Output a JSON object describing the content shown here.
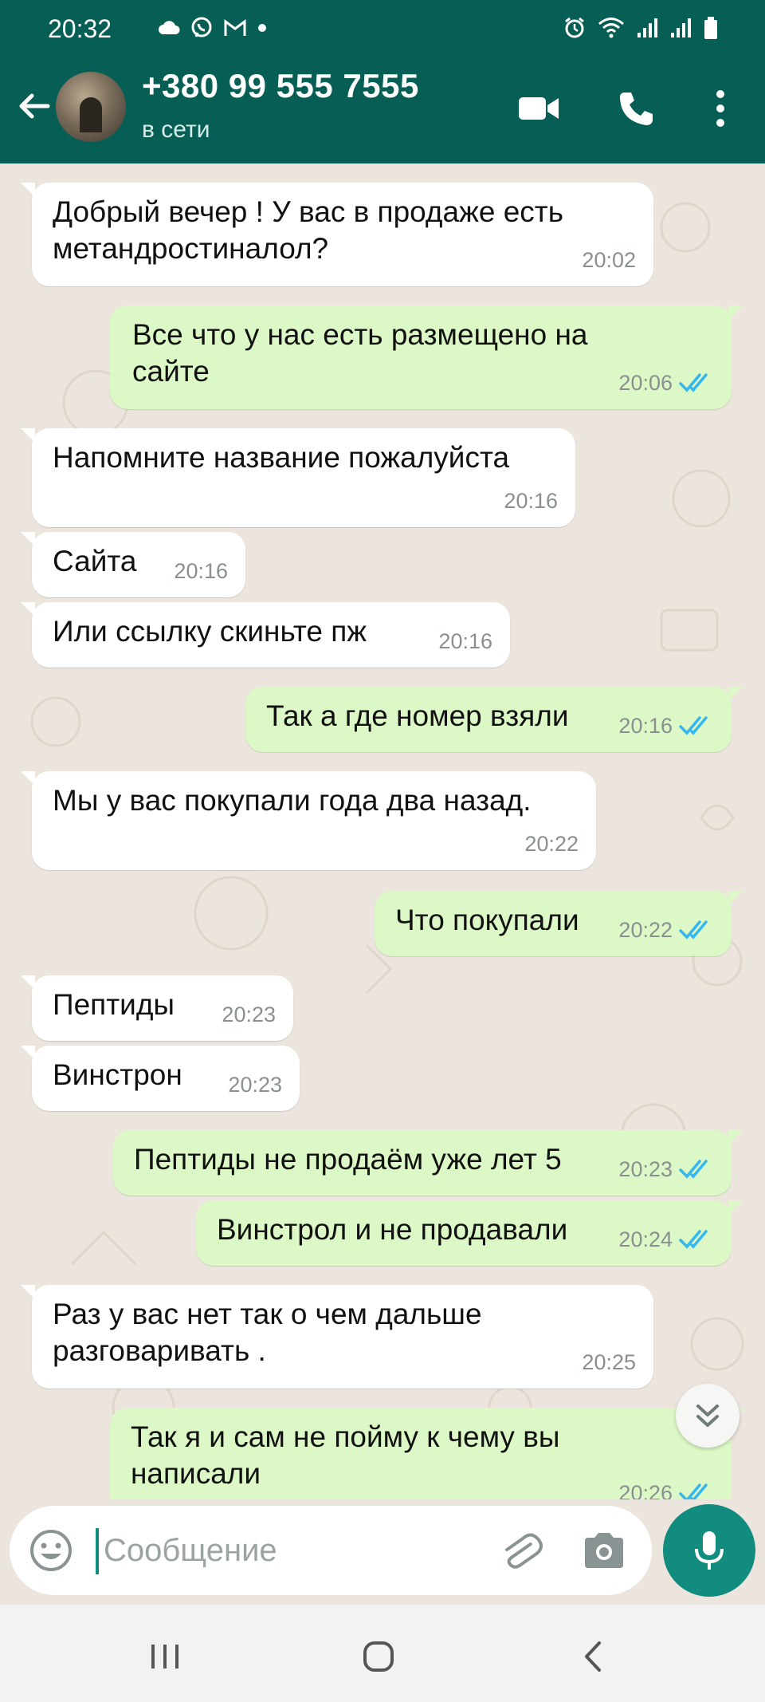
{
  "statusbar": {
    "time": "20:32"
  },
  "header": {
    "contact_name": "+380 99 555 7555",
    "contact_status": "в сети"
  },
  "messages": [
    {
      "dir": "in",
      "text": "Добрый вечер ! У вас в продаже есть метандростиналол?",
      "time": "20:02"
    },
    {
      "dir": "out",
      "text": "Все что у нас есть размещено на сайте",
      "time": "20:06"
    },
    {
      "dir": "in",
      "text": "Напомните название пожалуйста",
      "time": "20:16"
    },
    {
      "dir": "in",
      "text": "Сайта",
      "time": "20:16"
    },
    {
      "dir": "in",
      "text": "Или ссылку скиньте пж",
      "time": "20:16"
    },
    {
      "dir": "out",
      "text": "Так а где номер взяли",
      "time": "20:16"
    },
    {
      "dir": "in",
      "text": "Мы у вас покупали года два назад.",
      "time": "20:22"
    },
    {
      "dir": "out",
      "text": "Что покупали",
      "time": "20:22"
    },
    {
      "dir": "in",
      "text": "Пептиды",
      "time": "20:23"
    },
    {
      "dir": "in",
      "text": "Винстрон",
      "time": "20:23"
    },
    {
      "dir": "out",
      "text": "Пептиды не продаём уже лет 5",
      "time": "20:23"
    },
    {
      "dir": "out",
      "text": "Винстрол и не продавали",
      "time": "20:24"
    },
    {
      "dir": "in",
      "text": "Раз у вас нет так о чем дальше разговаривать .",
      "time": "20:25"
    },
    {
      "dir": "out",
      "text": "Так я и сам не пойму к чему вы написали",
      "time": "20:26"
    }
  ],
  "composer": {
    "placeholder": "Сообщение"
  },
  "icons": {
    "back": "arrow-left-icon",
    "video": "video-call-icon",
    "phone": "phone-call-icon",
    "menu": "more-vert-icon",
    "emoji": "emoji-icon",
    "attach": "paperclip-icon",
    "camera": "camera-icon",
    "mic": "microphone-icon",
    "scroll": "double-chevron-down-icon",
    "read": "double-check-icon"
  },
  "colors": {
    "header": "#075e54",
    "accent": "#128c7e",
    "outgoing_bubble": "#dcf8c6",
    "incoming_bubble": "#ffffff",
    "read_tick": "#34b7f1",
    "chat_background": "#ece5dd"
  }
}
